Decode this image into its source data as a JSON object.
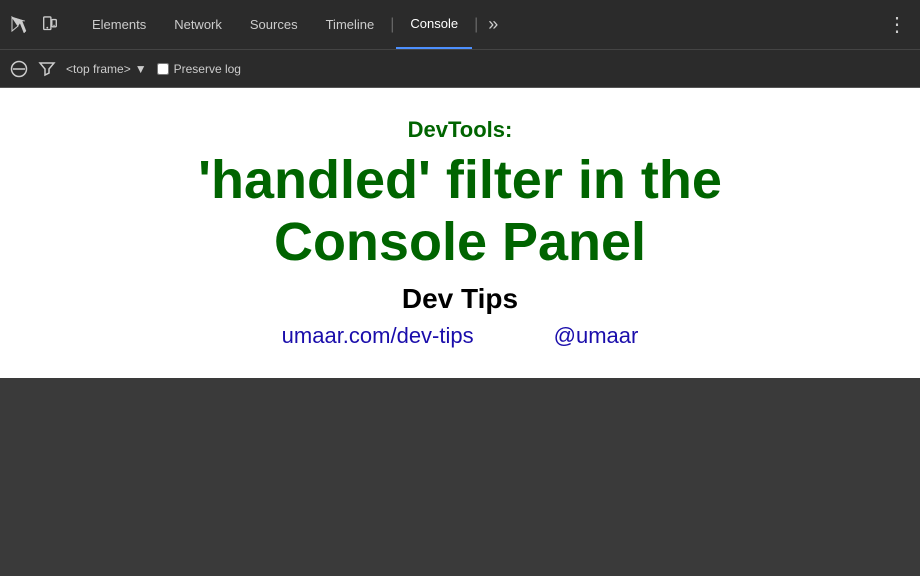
{
  "toolbar": {
    "tabs": [
      {
        "id": "elements",
        "label": "Elements",
        "active": false
      },
      {
        "id": "network",
        "label": "Network",
        "active": false
      },
      {
        "id": "sources",
        "label": "Sources",
        "active": false
      },
      {
        "id": "timeline",
        "label": "Timeline",
        "active": false
      },
      {
        "id": "console",
        "label": "Console",
        "active": true
      }
    ],
    "more_label": "»",
    "menu_label": "⋮"
  },
  "consolebar": {
    "frame_label": "<top frame>",
    "preserve_log_label": "Preserve log"
  },
  "main": {
    "devtools_label": "DevTools:",
    "heading_line1": "'handled' filter in the",
    "heading_line2": "Console Panel",
    "dev_tips_label": "Dev Tips",
    "link_url": "umaar.com/dev-tips",
    "link_twitter": "@umaar"
  }
}
